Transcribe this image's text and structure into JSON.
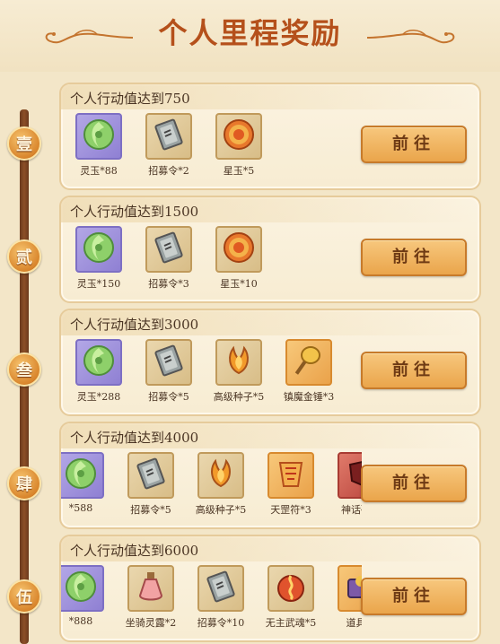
{
  "page": {
    "title": "个人里程奖励"
  },
  "colors": {
    "accent": "#b5501b",
    "button": "#eaa54b",
    "timeline": "#6b3a1d"
  },
  "tiers": [
    {
      "node": "壹",
      "title": "个人行动值达到750",
      "button": "前往",
      "items": [
        {
          "label": "灵玉*88",
          "icon": "jade-icon",
          "frame": "purple"
        },
        {
          "label": "招募令*2",
          "icon": "recruit-token-icon",
          "frame": "tan"
        },
        {
          "label": "星玉*5",
          "icon": "star-jade-icon",
          "frame": "tan"
        }
      ]
    },
    {
      "node": "贰",
      "title": "个人行动值达到1500",
      "button": "前往",
      "items": [
        {
          "label": "灵玉*150",
          "icon": "jade-icon",
          "frame": "purple"
        },
        {
          "label": "招募令*3",
          "icon": "recruit-token-icon",
          "frame": "tan"
        },
        {
          "label": "星玉*10",
          "icon": "star-jade-icon",
          "frame": "tan"
        }
      ]
    },
    {
      "node": "叁",
      "title": "个人行动值达到3000",
      "button": "前往",
      "items": [
        {
          "label": "灵玉*288",
          "icon": "jade-icon",
          "frame": "purple"
        },
        {
          "label": "招募令*5",
          "icon": "recruit-token-icon",
          "frame": "tan"
        },
        {
          "label": "高级种子*5",
          "icon": "seed-icon",
          "frame": "tan"
        },
        {
          "label": "镇魔金锤*3",
          "icon": "golden-hammer-icon",
          "frame": "orange"
        }
      ]
    },
    {
      "node": "肆",
      "title": "个人行动值达到4000",
      "button": "前往",
      "items": [
        {
          "label": "*588",
          "icon": "jade-icon",
          "frame": "purple"
        },
        {
          "label": "招募令*5",
          "icon": "recruit-token-icon",
          "frame": "tan"
        },
        {
          "label": "高级种子*5",
          "icon": "seed-icon",
          "frame": "tan"
        },
        {
          "label": "天罡符*3",
          "icon": "talisman-icon",
          "frame": "orange"
        },
        {
          "label": "神话碎片",
          "icon": "myth-fragment-icon",
          "frame": "red"
        }
      ]
    },
    {
      "node": "伍",
      "title": "个人行动值达到6000",
      "button": "前往",
      "items": [
        {
          "label": "*888",
          "icon": "jade-icon",
          "frame": "purple"
        },
        {
          "label": "坐骑灵露*2",
          "icon": "mount-potion-icon",
          "frame": "tan"
        },
        {
          "label": "招募令*10",
          "icon": "recruit-token-icon",
          "frame": "tan"
        },
        {
          "label": "无主武魂*5",
          "icon": "weapon-soul-icon",
          "frame": "tan"
        },
        {
          "label": "道具自",
          "icon": "item-chest-icon",
          "frame": "orange"
        }
      ]
    }
  ]
}
